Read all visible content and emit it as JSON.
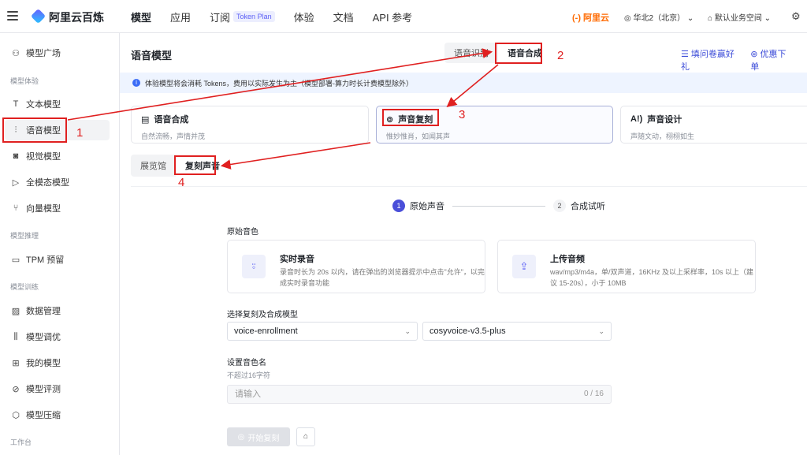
{
  "topbar": {
    "brand": "阿里云百炼",
    "nav": [
      "模型",
      "应用",
      "订阅",
      "体验",
      "文档",
      "API 参考"
    ],
    "plan_badge": "Token Plan",
    "aliyun": "(-) 阿里云",
    "region": "华北2（北京）",
    "workspace": "默认业务空间"
  },
  "sidebar": {
    "items": [
      "模型广场",
      "文本模型",
      "语音模型",
      "视觉模型",
      "全模态模型",
      "向量模型",
      "TPM 预留",
      "数据管理",
      "模型调优",
      "我的模型",
      "模型评测",
      "模型压缩"
    ],
    "groups": [
      "模型体验",
      "模型推理",
      "模型训练",
      "工作台"
    ]
  },
  "main": {
    "title": "语音模型",
    "tabs": [
      "语音识别",
      "语音合成"
    ],
    "links": [
      "填问卷赢好礼",
      "优惠下单"
    ],
    "notice": "体验模型将会消耗 Tokens，费用以实际发生为主（模型部署-算力时长计费模型除外）",
    "cards": [
      {
        "title": "语音合成",
        "desc": "自然流畅，声情并茂"
      },
      {
        "title": "声音复刻",
        "desc": "惟妙惟肖，如闻其声"
      },
      {
        "title": "声音设计",
        "desc": "声随文动，栩栩如生"
      }
    ],
    "subtabs": [
      "展览馆",
      "复刻声音"
    ],
    "steps": [
      {
        "num": "1",
        "label": "原始声音"
      },
      {
        "num": "2",
        "label": "合成试听"
      }
    ],
    "voice_section": "原始音色",
    "options": [
      {
        "title": "实时录音",
        "desc": "录音时长为 20s 以内，请在弹出的浏览器提示中点击\"允许\"，以完成实时录音功能"
      },
      {
        "title": "上传音频",
        "desc": "wav/mp3/m4a，单/双声道，16KHz 及以上采样率，10s 以上（建议 15-20s），小于 10MB"
      }
    ],
    "model_section": "选择复刻及合成模型",
    "selects": [
      "voice-enrollment",
      "cosyvoice-v3.5-plus"
    ],
    "name_section": "设置音色名",
    "name_hint": "不超过16字符",
    "name_placeholder": "请输入",
    "name_count": "0 / 16",
    "start_button": "开始复刻"
  },
  "annotations": [
    "1",
    "2",
    "3",
    "4"
  ],
  "colors": {
    "accent": "#4a4fd9",
    "annotation": "#e02020",
    "notice_bg": "#eef4ff"
  }
}
